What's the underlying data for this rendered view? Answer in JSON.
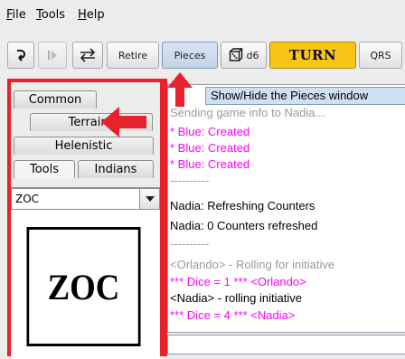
{
  "menu": [
    {
      "label": "File",
      "mnemonic": "F",
      "rest": "ile"
    },
    {
      "label": "Tools",
      "mnemonic": "T",
      "rest": "ools"
    },
    {
      "label": "Help",
      "mnemonic": "H",
      "rest": "elp"
    }
  ],
  "toolbar": {
    "retire": "Retire",
    "pieces": "Pieces",
    "d6": "d6",
    "turn": "TURN",
    "qrs": "QRS"
  },
  "tooltip": "Show/Hide the Pieces window",
  "tabs": {
    "common": "Common",
    "terrains": "Terrains",
    "helenistic": "Helenistic",
    "tools": "Tools",
    "indians": "Indians"
  },
  "combo": {
    "selected": "ZOC"
  },
  "piece": {
    "label": "ZOC"
  },
  "log": [
    {
      "text": "Sending game info to Nadia...",
      "color": "#9a9a9a"
    },
    {
      "text": "* Blue: Created",
      "color": "#ff00ff"
    },
    {
      "text": "* Blue: Created",
      "color": "#ff00ff"
    },
    {
      "text": "* Blue: Created",
      "color": "#ff00ff"
    },
    {
      "text": "----------",
      "color": "#9a9a9a"
    },
    {
      "text": "Nadia: Refreshing Counters",
      "color": "#000000"
    },
    {
      "text": "Nadia: 0 Counters refreshed",
      "color": "#000000"
    },
    {
      "text": "----------",
      "color": "#9a9a9a"
    },
    {
      "text": "<Orlando> - Rolling for initiative",
      "color": "#9a9a9a"
    },
    {
      "text": "*** Dice = 1 *** <Orlando>",
      "color": "#ff00ff"
    },
    {
      "text": "<Nadia> - rolling initiative",
      "color": "#000000"
    },
    {
      "text": "*** Dice = 4 *** <Nadia>",
      "color": "#ff00ff"
    }
  ],
  "colors": {
    "highlight": "#e8222c",
    "turn": "#f6c516",
    "chat_magenta": "#ff00ff"
  }
}
